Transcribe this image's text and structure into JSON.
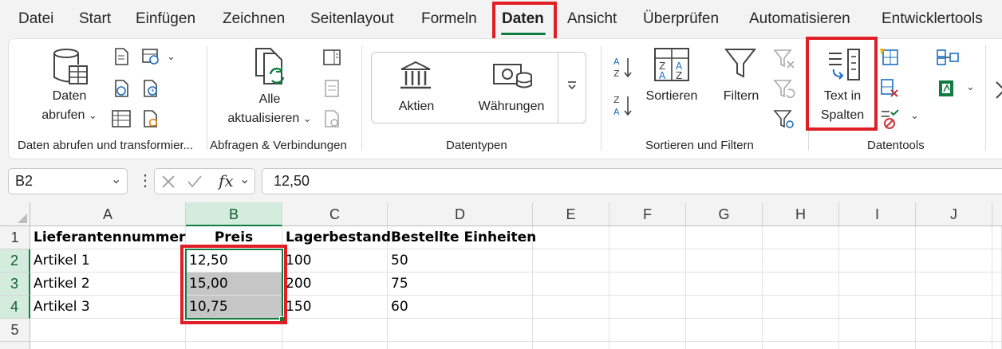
{
  "tabs": [
    "Datei",
    "Start",
    "Einfügen",
    "Zeichnen",
    "Seitenlayout",
    "Formeln",
    "Daten",
    "Ansicht",
    "Überprüfen",
    "Automatisieren",
    "Entwicklertools"
  ],
  "active_tab": "Daten",
  "ribbon": {
    "get_data": {
      "line1": "Daten",
      "line2": "abrufen"
    },
    "refresh_all": {
      "line1": "Alle",
      "line2": "aktualisieren"
    },
    "stocks": "Aktien",
    "currencies": "Währungen",
    "sort": "Sortieren",
    "filter": "Filtern",
    "text_to_columns": {
      "line1": "Text in",
      "line2": "Spalten"
    },
    "groups": {
      "get_transform": "Daten abrufen und transformier...",
      "queries": "Abfragen & Verbindungen",
      "data_types": "Datentypen",
      "sort_filter": "Sortieren und Filtern",
      "data_tools": "Datentools"
    }
  },
  "formula_bar": {
    "name_box": "B2",
    "fx": "fx",
    "value": "12,50"
  },
  "columns": [
    "A",
    "B",
    "C",
    "D",
    "E",
    "F",
    "G",
    "H",
    "I",
    "J"
  ],
  "rows": [
    "1",
    "2",
    "3",
    "4",
    "5"
  ],
  "cells": {
    "headers": [
      "Lieferantennummer",
      "Preis",
      "Lagerbestand",
      "Bestellte Einheiten"
    ],
    "data": [
      [
        "Artikel 1",
        "12,50",
        "100",
        "50"
      ],
      [
        "Artikel 2",
        "15,00",
        "200",
        "75"
      ],
      [
        "Artikel 3",
        "10,75",
        "150",
        "60"
      ]
    ]
  },
  "colors": {
    "accent": "#107c41",
    "highlight_box": "#e01e25",
    "selection_fill": "#c6c6c6"
  }
}
